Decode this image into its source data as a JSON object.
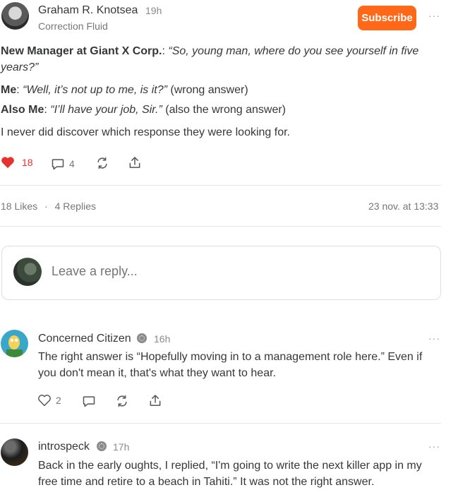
{
  "post": {
    "author": "Graham R. Knotsea",
    "time": "19h",
    "publication": "Correction Fluid",
    "subscribe_label": "Subscribe",
    "more": "···",
    "lines": [
      {
        "bold": "New Manager at Giant X Corp.",
        "sep": ": ",
        "italic": "“So, young man, where do you see yourself in five years?”",
        "tail": ""
      },
      {
        "bold": "Me",
        "sep": ": ",
        "italic": "“Well, it’s not up to me, is it?”",
        "tail": " (wrong answer)"
      },
      {
        "bold": "Also Me",
        "sep": ": ",
        "italic": "“I’ll have your job, Sir.”",
        "tail": " (also the wrong answer)"
      },
      {
        "bold": "",
        "sep": "",
        "italic": "",
        "tail": "I never did discover which response they were looking for."
      }
    ],
    "like_count": "18",
    "comment_count": "4",
    "likes_label": "18 Likes",
    "dot": "·",
    "replies_label": "4 Replies",
    "timestamp": "23 nov. at 13:33",
    "like_color": "#e5322d"
  },
  "reply": {
    "placeholder": "Leave a reply..."
  },
  "comments": [
    {
      "author": "Concerned Citizen",
      "time": "16h",
      "more": "···",
      "text": "The right answer is “Hopefully moving in to a management role here.” Even if you don't mean it, that's what they want to hear.",
      "like_count": "2"
    },
    {
      "author": "introspeck",
      "time": "17h",
      "more": "···",
      "text": "Back in the early oughts, I replied, “I'm going to write the next killer app in my free time and retire to a beach in Tahiti.” It was not the right answer."
    }
  ],
  "colors": {
    "accent": "#ff6719",
    "text": "#363737",
    "muted": "#777777"
  }
}
